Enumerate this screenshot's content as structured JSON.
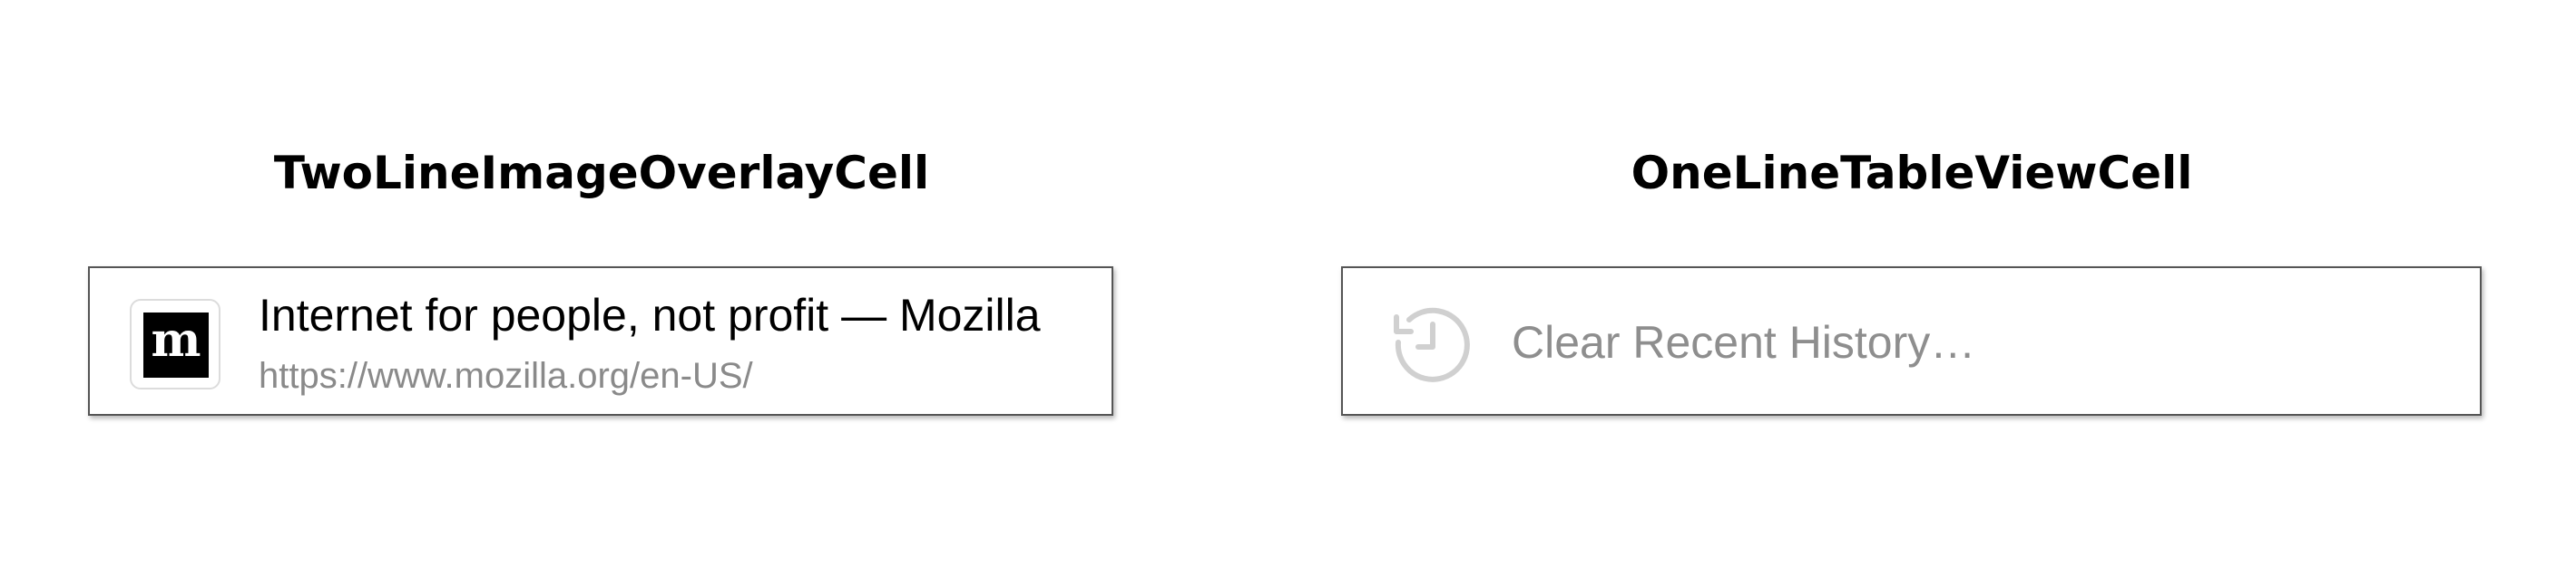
{
  "sections": {
    "left": {
      "title": "TwoLineImageOverlayCell",
      "cell": {
        "favicon_letter": "m",
        "favicon_icon": "mozilla-logo-icon",
        "title": "Internet for people, not profit — Mozilla",
        "url": "https://www.mozilla.org/en-US/"
      }
    },
    "right": {
      "title": "OneLineTableViewCell",
      "cell": {
        "icon": "history-icon",
        "label": "Clear Recent History…"
      }
    }
  },
  "colors": {
    "title": "#000000",
    "subtitle": "#8a8a8a",
    "disabled_label": "#8e8e8e",
    "icon": "#d0d0d0",
    "cell_border": "#555555"
  }
}
